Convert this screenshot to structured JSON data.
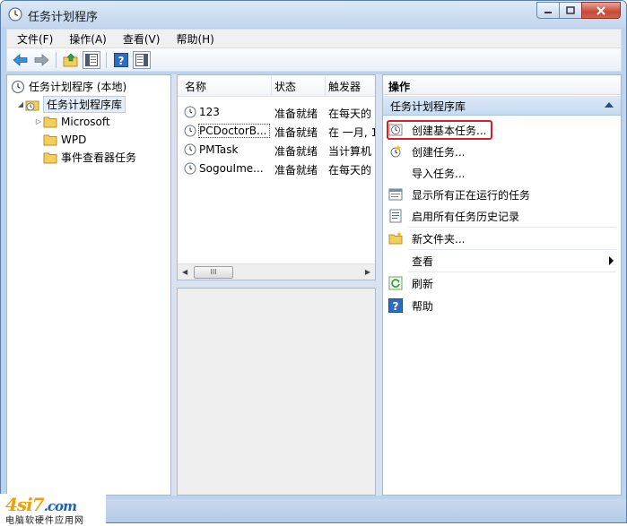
{
  "window": {
    "title": "任务计划程序"
  },
  "menu": [
    "文件(F)",
    "操作(A)",
    "查看(V)",
    "帮助(H)"
  ],
  "toolbar": {
    "icons": [
      "back-arrow-icon",
      "forward-arrow-icon",
      "up-folder-icon",
      "show-hide-tree-icon",
      "help-icon",
      "show-hide-action-icon"
    ]
  },
  "tree": {
    "root": "任务计划程序 (本地)",
    "library": "任务计划程序库",
    "children": [
      "Microsoft",
      "WPD",
      "事件查看器任务"
    ]
  },
  "task_list": {
    "columns": [
      "名称",
      "状态",
      "触发器"
    ],
    "rows": [
      {
        "name": "123",
        "status": "准备就绪",
        "trigger": "在每天的"
      },
      {
        "name": "PCDoctorB...",
        "status": "准备就绪",
        "trigger": "在 一月, 1"
      },
      {
        "name": "PMTask",
        "status": "准备就绪",
        "trigger": "当计算机"
      },
      {
        "name": "SogouIme...",
        "status": "准备就绪",
        "trigger": "在每天的"
      }
    ],
    "scroll_thumb": "III"
  },
  "actions": {
    "header": "操作",
    "section": "任务计划程序库",
    "items": [
      {
        "label": "创建基本任务...",
        "icon": "create-basic-task-icon"
      },
      {
        "label": "创建任务...",
        "icon": "create-task-icon"
      },
      {
        "label": "导入任务...",
        "icon": "none"
      },
      {
        "label": "显示所有正在运行的任务",
        "icon": "running-tasks-icon"
      },
      {
        "label": "启用所有任务历史记录",
        "icon": "history-icon"
      },
      {
        "label": "新文件夹...",
        "icon": "new-folder-icon"
      },
      {
        "label": "查看",
        "icon": "none"
      },
      {
        "label": "刷新",
        "icon": "refresh-icon"
      },
      {
        "label": "帮助",
        "icon": "help-icon"
      }
    ]
  },
  "watermark": {
    "logo_main": "4si7",
    "logo_suffix": ".com",
    "subtitle": "电脑软硬件应用网"
  },
  "colors": {
    "highlight_box": "#d4212a",
    "section_bg": "#c6dbf1",
    "watermark_blue": "#1e5fb5",
    "watermark_orange": "#f0a000"
  }
}
